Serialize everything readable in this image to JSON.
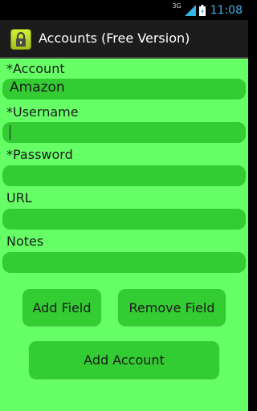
{
  "status_bar": {
    "network_type": "3G",
    "time": "11:08",
    "icons": [
      "signal-icon",
      "battery-icon"
    ]
  },
  "action_bar": {
    "title": "Accounts (Free Version)",
    "icon": "lock-app-icon"
  },
  "form": {
    "fields": [
      {
        "label": "*Account",
        "value": "Amazon"
      },
      {
        "label": "*Username",
        "value": ""
      },
      {
        "label": "*Password",
        "value": ""
      },
      {
        "label": "URL",
        "value": ""
      },
      {
        "label": "Notes",
        "value": ""
      }
    ],
    "buttons": {
      "add_field": "Add Field",
      "remove_field": "Remove Field",
      "add_account": "Add Account"
    }
  },
  "colors": {
    "form_background": "#66ff66",
    "field_background": "#33cc33",
    "action_bar": "#1c1c1c",
    "status_accent": "#33b5e5"
  }
}
